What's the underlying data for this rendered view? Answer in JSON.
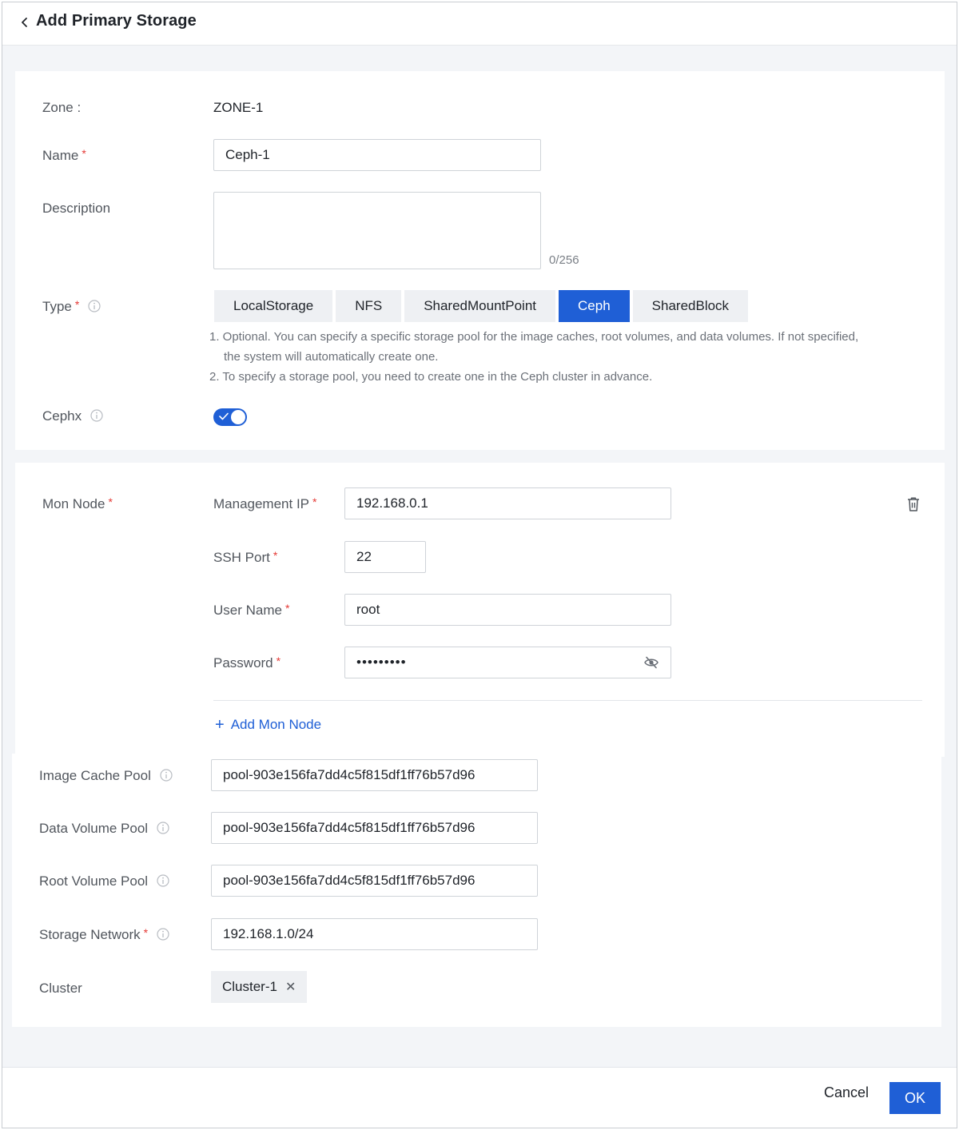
{
  "header": {
    "title": "Add Primary Storage"
  },
  "form": {
    "zone": {
      "label": "Zone :",
      "value": "ZONE-1"
    },
    "name": {
      "label": "Name",
      "value": "Ceph-1"
    },
    "description": {
      "label": "Description",
      "value": "",
      "counter": "0/256"
    },
    "type": {
      "label": "Type",
      "options": [
        "LocalStorage",
        "NFS",
        "SharedMountPoint",
        "Ceph",
        "SharedBlock"
      ],
      "selected": "Ceph",
      "hint_line1": "1. Optional. You can specify a specific storage pool for the image caches, root volumes, and data volumes. If not specified,",
      "hint_line1b": "the system will automatically create one.",
      "hint_line2": "2. To specify a storage pool, you need to create one in the Ceph cluster in advance."
    },
    "cephx": {
      "label": "Cephx",
      "enabled": true
    }
  },
  "mon_node": {
    "label": "Mon Node",
    "management_ip": {
      "label": "Management IP",
      "value": "192.168.0.1"
    },
    "ssh_port": {
      "label": "SSH Port",
      "value": "22"
    },
    "user_name": {
      "label": "User Name",
      "value": "root"
    },
    "password": {
      "label": "Password",
      "value": "•••••••••"
    },
    "add_label": "Add Mon Node"
  },
  "pools": {
    "image_cache": {
      "label": "Image Cache Pool",
      "value": "pool-903e156fa7dd4c5f815df1ff76b57d96"
    },
    "data_volume": {
      "label": "Data Volume Pool",
      "value": "pool-903e156fa7dd4c5f815df1ff76b57d96"
    },
    "root_volume": {
      "label": "Root Volume Pool",
      "value": "pool-903e156fa7dd4c5f815df1ff76b57d96"
    },
    "storage_network": {
      "label": "Storage Network",
      "value": "192.168.1.0/24"
    },
    "cluster": {
      "label": "Cluster",
      "tag": "Cluster-1"
    }
  },
  "footer": {
    "cancel_label": "Cancel",
    "ok_label": "OK"
  },
  "colors": {
    "primary": "#1f5fd6",
    "required": "#e53935"
  }
}
